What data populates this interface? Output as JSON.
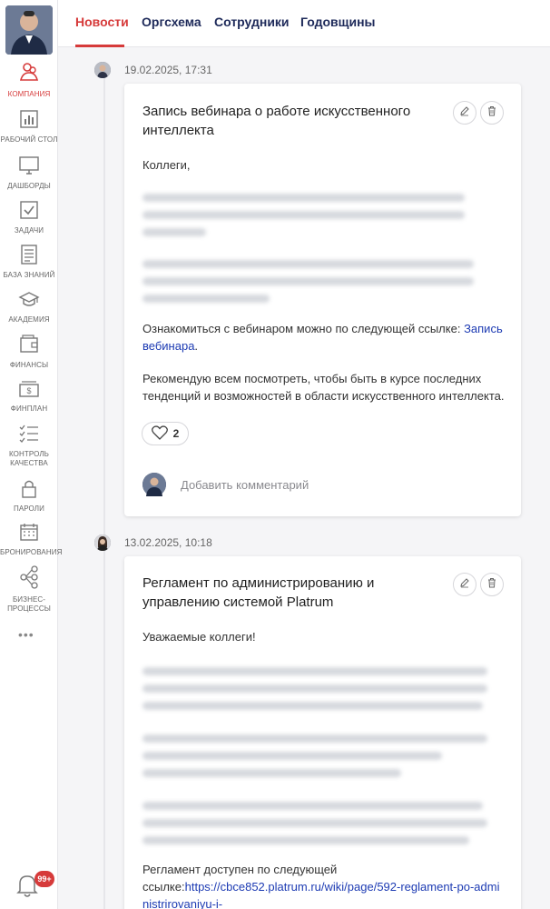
{
  "sidebar": {
    "items": [
      {
        "label": "КОМПАНИЯ",
        "icon": "company-icon",
        "active": true
      },
      {
        "label": "РАБОЧИЙ СТОЛ",
        "icon": "dashboard-chart-icon"
      },
      {
        "label": "ДАШБОРДЫ",
        "icon": "monitor-icon"
      },
      {
        "label": "ЗАДАЧИ",
        "icon": "checkbox-icon"
      },
      {
        "label": "БАЗА ЗНАНИЙ",
        "icon": "document-icon"
      },
      {
        "label": "АКАДЕМИЯ",
        "icon": "graduation-cap-icon"
      },
      {
        "label": "ФИНАНСЫ",
        "icon": "wallet-icon"
      },
      {
        "label": "ФИНПЛАН",
        "icon": "money-icon"
      },
      {
        "label_line1": "КОНТРОЛЬ",
        "label_line2": "КАЧЕСТВА",
        "icon": "checklist-icon"
      },
      {
        "label": "ПАРОЛИ",
        "icon": "lock-icon"
      },
      {
        "label": "БРОНИРОВАНИЯ",
        "icon": "calendar-icon"
      },
      {
        "label_line1": "БИЗНЕС-",
        "label_line2": "ПРОЦЕССЫ",
        "icon": "process-tree-icon"
      }
    ],
    "more": "•••",
    "notifications_badge": "99+",
    "accent_color": "#d63a3a"
  },
  "tabs": [
    "Новости",
    "Оргсхема",
    "Сотрудники",
    "Годовщины"
  ],
  "posts": [
    {
      "date": "19.02.2025, 17:31",
      "title": "Запись вебинара о работе искусственного интеллекта",
      "greeting": "Коллеги,",
      "link_sentence": "Ознакомиться с вебинаром можно по следующей ссылке: ",
      "link_text": "Запись вебинара",
      "link_suffix": ".",
      "closing": "Рекомендую всем посмотреть, чтобы быть в курсе последних тенденций и возможностей в области искусственного интеллекта.",
      "likes": "2",
      "comment_placeholder": "Добавить комментарий"
    },
    {
      "date": "13.02.2025, 10:18",
      "title": "Регламент по администрированию и управлению системой Platrum",
      "greeting": "Уважаемые коллеги!",
      "link_line1": "Регламент доступен по следующей",
      "link_prefix": "ссылке:",
      "link_text": "https://cbce852.platrum.ru/wiki/page/592-reglament-po-administrirovaniyu-i-"
    }
  ]
}
